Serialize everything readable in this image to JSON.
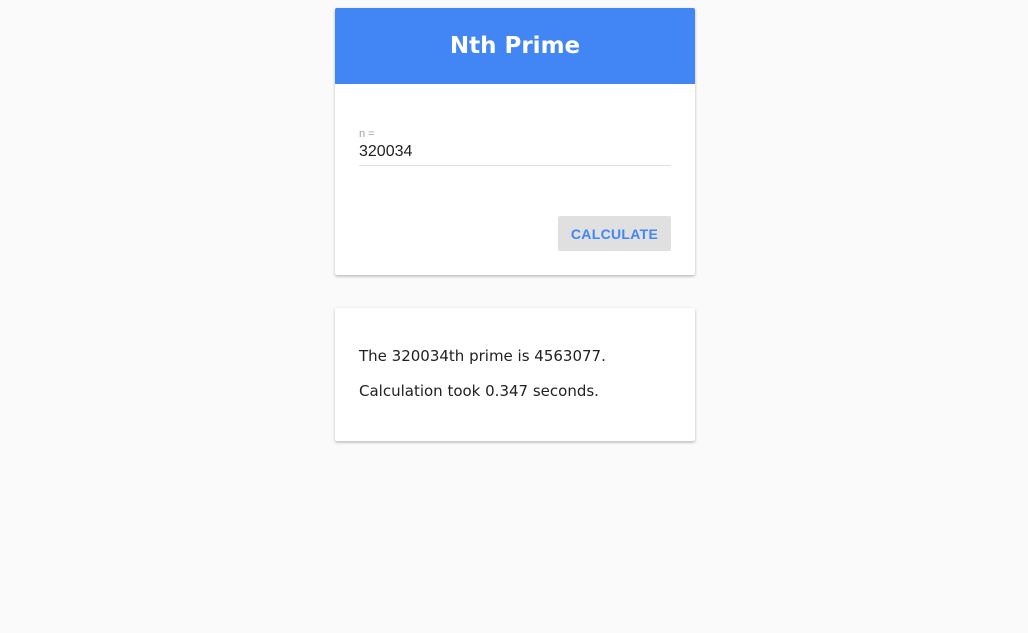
{
  "app": {
    "title": "Nth Prime"
  },
  "form": {
    "input_label": "n =",
    "input_value": "320034",
    "button_label": "CALCULATE"
  },
  "result": {
    "line1": "The 320034th prime is 4563077.",
    "line2": "Calculation took 0.347 seconds."
  },
  "colors": {
    "header": "#4285f4",
    "button_bg": "#e0e0e0",
    "button_text": "#4285f4",
    "page_bg": "#fafafa"
  }
}
